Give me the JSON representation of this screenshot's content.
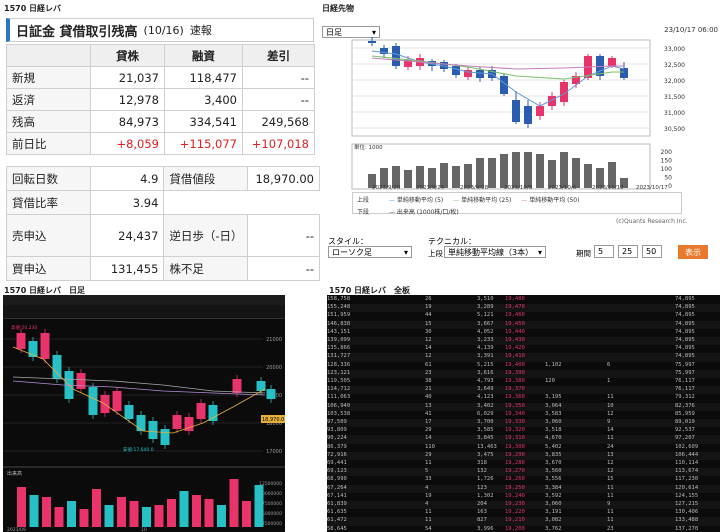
{
  "tl": {
    "caption": "1570 日経レバ",
    "title": "日証金 貸借取引残高",
    "date": "(10/16)",
    "suffix": "速報",
    "headers": [
      "",
      "貸株",
      "融資",
      "差引"
    ],
    "rows": [
      {
        "label": "新規",
        "a": "21,037",
        "b": "118,477",
        "c": "--",
        "red": false
      },
      {
        "label": "返済",
        "a": "12,978",
        "b": "3,400",
        "c": "--",
        "red": false
      },
      {
        "label": "残高",
        "a": "84,973",
        "b": "334,541",
        "c": "249,568",
        "red": false
      },
      {
        "label": "前日比",
        "a": "+8,059",
        "b": "+115,077",
        "c": "+107,018",
        "red": true
      }
    ],
    "rows2": [
      {
        "l1": "回転日数",
        "v1": "4.9",
        "l2": "貸借値段",
        "v2": "18,970.00"
      },
      {
        "l1": "貸借比率",
        "v1": "3.94",
        "l2": "",
        "v2": ""
      },
      {
        "l1": "売申込",
        "v1": "24,437",
        "l2": "逆日歩（-日）",
        "v2": "--"
      },
      {
        "l1": "買申込",
        "v1": "131,455",
        "l2": "株不足",
        "v2": "--"
      }
    ]
  },
  "tr": {
    "caption": "日経先物",
    "period_select": "日足",
    "timestamp": "23/10/17 06:00",
    "y_ticks": [
      "33,000",
      "32,500",
      "32,000",
      "31,500",
      "31,000",
      "30,500"
    ],
    "vol_unit": "単位: 1000",
    "vol_ticks": [
      "200",
      "150",
      "100",
      "50",
      "0"
    ],
    "x_ticks": [
      "2023/9/20",
      "2023/9/25",
      "2023/9/28",
      "2023/10/3",
      "2023/10/6",
      "2023/10/12",
      "2023/10/17"
    ],
    "legend_upper_label": "上段",
    "legend_upper": [
      "単純移動平均 (5)",
      "単純移動平均 (25)",
      "単純移動平均 (50)"
    ],
    "legend_lower_label": "下段",
    "legend_lower": "出来高 (1000株/口/枚)",
    "credit": "(c)Quants Research Inc.",
    "style_label": "スタイル：",
    "style_value": "ローソク足",
    "tech_label": "テクニカル：",
    "tech_pos": "上段",
    "tech_value": "単純移動平均線（3本）",
    "period_label": "期間",
    "p1": "5",
    "p2": "25",
    "p3": "50",
    "show_btn": "表示",
    "colors": {
      "up": "#e8336b",
      "down": "#2a5db0",
      "ma5": "#5b9bd5",
      "ma25": "#7bbf6a",
      "ma50": "#c77dbb"
    }
  },
  "bl": {
    "caption": "1570 日経レバ　日足",
    "price_label": "18,970.0",
    "low_label": "安値:17,640.0",
    "high_label": "高値:20,230",
    "volume_label": "出来高",
    "y_ticks": [
      "21000",
      "20000",
      "19000",
      "18000",
      "17000"
    ],
    "v_ticks": [
      "12500000",
      "10000000",
      "7500000",
      "5000000",
      "2500000"
    ],
    "x_ticks": [
      "2023/09",
      "10"
    ]
  },
  "br": {
    "caption": "1570 日経レバ　全板",
    "rows": [
      [
        "158,758",
        "26",
        "3,510",
        "19,480",
        "",
        "",
        "74,895"
      ],
      [
        "155,248",
        "19",
        "3,289",
        "19,470",
        "",
        "",
        "74,895"
      ],
      [
        "151,959",
        "44",
        "5,121",
        "19,460",
        "",
        "",
        "74,895"
      ],
      [
        "146,838",
        "15",
        "3,667",
        "19,450",
        "",
        "",
        "74,895"
      ],
      [
        "143,151",
        "30",
        "4,052",
        "19,440",
        "",
        "",
        "74,895"
      ],
      [
        "139,099",
        "12",
        "3,233",
        "19,430",
        "",
        "",
        "74,895"
      ],
      [
        "135,866",
        "14",
        "4,139",
        "19,420",
        "",
        "",
        "74,895"
      ],
      [
        "131,727",
        "12",
        "3,391",
        "19,410",
        "",
        "",
        "74,895"
      ],
      [
        "128,336",
        "61",
        "5,215",
        "19,400",
        "1,102",
        "6",
        "75,997"
      ],
      [
        "123,121",
        "23",
        "3,616",
        "19,390",
        "",
        "",
        "75,997"
      ],
      [
        "119,505",
        "38",
        "4,793",
        "19,380",
        "120",
        "1",
        "76,117"
      ],
      [
        "114,712",
        "21",
        "3,649",
        "19,370",
        "",
        "",
        "76,117"
      ],
      [
        "111,063",
        "40",
        "4,123",
        "19,360",
        "3,195",
        "11",
        "79,312"
      ],
      [
        "106,940",
        "13",
        "3,402",
        "19,350",
        "3,064",
        "10",
        "82,376"
      ],
      [
        "103,538",
        "41",
        "6,029",
        "19,340",
        "3,583",
        "12",
        "85,959"
      ],
      [
        "97,509",
        "17",
        "3,700",
        "19,330",
        "3,060",
        "9",
        "89,019"
      ],
      [
        "93,809",
        "29",
        "3,585",
        "19,320",
        "3,518",
        "14",
        "92,537"
      ],
      [
        "90,224",
        "14",
        "3,845",
        "19,310",
        "4,670",
        "11",
        "97,207"
      ],
      [
        "86,379",
        "110",
        "13,463",
        "19,300",
        "5,402",
        "24",
        "102,609"
      ],
      [
        "72,916",
        "29",
        "3,475",
        "19,290",
        "3,835",
        "13",
        "106,444"
      ],
      [
        "69,441",
        "11",
        "318",
        "19,280",
        "3,670",
        "12",
        "110,114"
      ],
      [
        "69,123",
        "5",
        "132",
        "19,270",
        "3,560",
        "12",
        "113,674"
      ],
      [
        "68,990",
        "33",
        "1,726",
        "19,260",
        "3,556",
        "15",
        "117,230"
      ],
      [
        "67,264",
        "4",
        "123",
        "19,250",
        "3,384",
        "11",
        "120,614"
      ],
      [
        "67,141",
        "19",
        "1,302",
        "19,240",
        "3,592",
        "11",
        "124,155"
      ],
      [
        "61,839",
        "4",
        "204",
        "19,230",
        "3,060",
        "9",
        "127,215"
      ],
      [
        "61,635",
        "11",
        "163",
        "19,220",
        "3,191",
        "11",
        "130,406"
      ],
      [
        "61,472",
        "11",
        "827",
        "19,210",
        "3,082",
        "11",
        "133,488"
      ],
      [
        "58,645",
        "54",
        "3,996",
        "19,200",
        "3,762",
        "23",
        "137,270"
      ]
    ]
  }
}
